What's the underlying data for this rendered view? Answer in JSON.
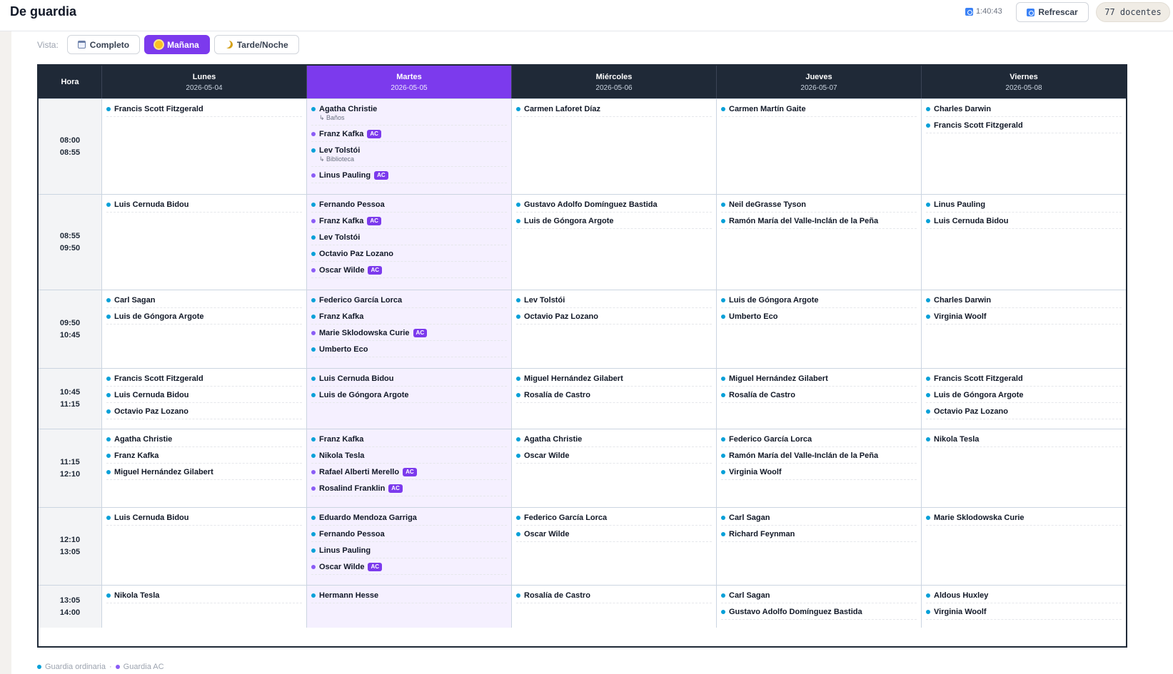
{
  "header": {
    "title": "De guardia",
    "clock": "1:40:43",
    "refresh_label": "Refrescar",
    "count_label": "77 docentes"
  },
  "view": {
    "label": "Vista:",
    "options": [
      {
        "label": "Completo",
        "icon": "calendar-icon",
        "active": false
      },
      {
        "label": "Mañana",
        "icon": "sun-icon",
        "active": true
      },
      {
        "label": "Tarde/Noche",
        "icon": "moon-icon",
        "active": false
      }
    ]
  },
  "colors": {
    "accent": "#7c3aed",
    "ordinaria_dot": "#06a0d8",
    "ac_dot": "#8b5cf6",
    "header_bg": "#1f2937"
  },
  "schedule": {
    "hour_header": "Hora",
    "days": [
      {
        "name": "Lunes",
        "date": "2026-05-04",
        "today": false
      },
      {
        "name": "Martes",
        "date": "2026-05-05",
        "today": true
      },
      {
        "name": "Miércoles",
        "date": "2026-05-06",
        "today": false
      },
      {
        "name": "Jueves",
        "date": "2026-05-07",
        "today": false
      },
      {
        "name": "Viernes",
        "date": "2026-05-08",
        "today": false
      }
    ],
    "rows": [
      {
        "start": "08:00",
        "end": "08:55",
        "cells": [
          [
            {
              "name": "Francis Scott Fitzgerald",
              "ac": false
            }
          ],
          [
            {
              "name": "Agatha Christie",
              "ac": false,
              "sub": "↳ Baños"
            },
            {
              "name": "Franz Kafka",
              "ac": true
            },
            {
              "name": "Lev Tolstói",
              "ac": false,
              "sub": "↳ Biblioteca"
            },
            {
              "name": "Linus Pauling",
              "ac": true
            }
          ],
          [
            {
              "name": "Carmen Laforet Díaz",
              "ac": false
            }
          ],
          [
            {
              "name": "Carmen Martín Gaite",
              "ac": false
            }
          ],
          [
            {
              "name": "Charles Darwin",
              "ac": false
            },
            {
              "name": "Francis Scott Fitzgerald",
              "ac": false
            }
          ]
        ]
      },
      {
        "start": "08:55",
        "end": "09:50",
        "cells": [
          [
            {
              "name": "Luis Cernuda Bidou",
              "ac": false
            }
          ],
          [
            {
              "name": "Fernando Pessoa",
              "ac": false
            },
            {
              "name": "Franz Kafka",
              "ac": true
            },
            {
              "name": "Lev Tolstói",
              "ac": false
            },
            {
              "name": "Octavio Paz Lozano",
              "ac": false
            },
            {
              "name": "Oscar Wilde",
              "ac": true
            }
          ],
          [
            {
              "name": "Gustavo Adolfo Domínguez Bastida",
              "ac": false
            },
            {
              "name": "Luis de Góngora Argote",
              "ac": false
            }
          ],
          [
            {
              "name": "Neil deGrasse Tyson",
              "ac": false
            },
            {
              "name": "Ramón María del Valle-Inclán de la Peña",
              "ac": false
            }
          ],
          [
            {
              "name": "Linus Pauling",
              "ac": false
            },
            {
              "name": "Luis Cernuda Bidou",
              "ac": false
            }
          ]
        ]
      },
      {
        "start": "09:50",
        "end": "10:45",
        "cells": [
          [
            {
              "name": "Carl Sagan",
              "ac": false
            },
            {
              "name": "Luis de Góngora Argote",
              "ac": false
            }
          ],
          [
            {
              "name": "Federico García Lorca",
              "ac": false
            },
            {
              "name": "Franz Kafka",
              "ac": false
            },
            {
              "name": "Marie Sklodowska Curie",
              "ac": true
            },
            {
              "name": "Umberto Eco",
              "ac": false
            }
          ],
          [
            {
              "name": "Lev Tolstói",
              "ac": false
            },
            {
              "name": "Octavio Paz Lozano",
              "ac": false
            }
          ],
          [
            {
              "name": "Luis de Góngora Argote",
              "ac": false
            },
            {
              "name": "Umberto Eco",
              "ac": false
            }
          ],
          [
            {
              "name": "Charles Darwin",
              "ac": false
            },
            {
              "name": "Virginia Woolf",
              "ac": false
            }
          ]
        ]
      },
      {
        "start": "10:45",
        "end": "11:15",
        "cells": [
          [
            {
              "name": "Francis Scott Fitzgerald",
              "ac": false
            },
            {
              "name": "Luis Cernuda Bidou",
              "ac": false
            },
            {
              "name": "Octavio Paz Lozano",
              "ac": false
            }
          ],
          [
            {
              "name": "Luis Cernuda Bidou",
              "ac": false
            },
            {
              "name": "Luis de Góngora Argote",
              "ac": false
            }
          ],
          [
            {
              "name": "Miguel Hernández Gilabert",
              "ac": false
            },
            {
              "name": "Rosalía de Castro",
              "ac": false
            }
          ],
          [
            {
              "name": "Miguel Hernández Gilabert",
              "ac": false
            },
            {
              "name": "Rosalía de Castro",
              "ac": false
            }
          ],
          [
            {
              "name": "Francis Scott Fitzgerald",
              "ac": false
            },
            {
              "name": "Luis de Góngora Argote",
              "ac": false
            },
            {
              "name": "Octavio Paz Lozano",
              "ac": false
            }
          ]
        ]
      },
      {
        "start": "11:15",
        "end": "12:10",
        "cells": [
          [
            {
              "name": "Agatha Christie",
              "ac": false
            },
            {
              "name": "Franz Kafka",
              "ac": false
            },
            {
              "name": "Miguel Hernández Gilabert",
              "ac": false
            }
          ],
          [
            {
              "name": "Franz Kafka",
              "ac": false
            },
            {
              "name": "Nikola Tesla",
              "ac": false
            },
            {
              "name": "Rafael Alberti Merello",
              "ac": true
            },
            {
              "name": "Rosalind Franklin",
              "ac": true
            }
          ],
          [
            {
              "name": "Agatha Christie",
              "ac": false
            },
            {
              "name": "Oscar Wilde",
              "ac": false
            }
          ],
          [
            {
              "name": "Federico García Lorca",
              "ac": false
            },
            {
              "name": "Ramón María del Valle-Inclán de la Peña",
              "ac": false
            },
            {
              "name": "Virginia Woolf",
              "ac": false
            }
          ],
          [
            {
              "name": "Nikola Tesla",
              "ac": false
            }
          ]
        ]
      },
      {
        "start": "12:10",
        "end": "13:05",
        "cells": [
          [
            {
              "name": "Luis Cernuda Bidou",
              "ac": false
            }
          ],
          [
            {
              "name": "Eduardo Mendoza Garriga",
              "ac": false
            },
            {
              "name": "Fernando Pessoa",
              "ac": false
            },
            {
              "name": "Linus Pauling",
              "ac": false
            },
            {
              "name": "Oscar Wilde",
              "ac": true
            }
          ],
          [
            {
              "name": "Federico García Lorca",
              "ac": false
            },
            {
              "name": "Oscar Wilde",
              "ac": false
            }
          ],
          [
            {
              "name": "Carl Sagan",
              "ac": false
            },
            {
              "name": "Richard Feynman",
              "ac": false
            }
          ],
          [
            {
              "name": "Marie Sklodowska Curie",
              "ac": false
            }
          ]
        ]
      },
      {
        "start": "13:05",
        "end": "14:00",
        "cells": [
          [
            {
              "name": "Nikola Tesla",
              "ac": false
            }
          ],
          [
            {
              "name": "Hermann Hesse",
              "ac": false
            }
          ],
          [
            {
              "name": "Rosalía de Castro",
              "ac": false
            }
          ],
          [
            {
              "name": "Carl Sagan",
              "ac": false
            },
            {
              "name": "Gustavo Adolfo Domínguez Bastida",
              "ac": false
            }
          ],
          [
            {
              "name": "Aldous Huxley",
              "ac": false
            },
            {
              "name": "Virginia Woolf",
              "ac": false
            }
          ]
        ]
      }
    ]
  },
  "legend": {
    "ordinaria": "Guardia ordinaria",
    "separator": "·",
    "ac": "Guardia AC"
  }
}
